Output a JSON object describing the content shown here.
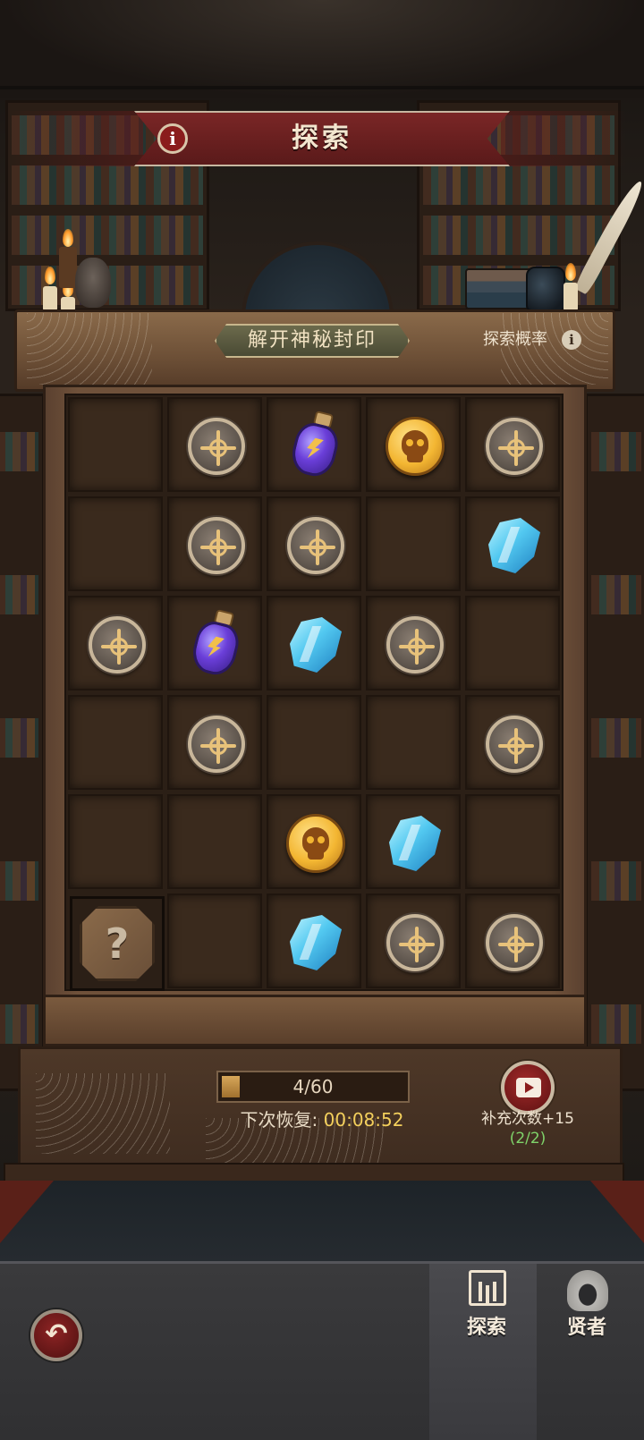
{
  "header": {
    "title": "探索",
    "info_label": "i"
  },
  "unseal_label": "解开神秘封印",
  "probability_label": "探索概率",
  "probability_info": "i",
  "grid": {
    "rows": [
      [
        "empty",
        "medal",
        "potion",
        "coin",
        "medal"
      ],
      [
        "empty",
        "medal",
        "medal",
        "empty",
        "crystal"
      ],
      [
        "medal",
        "potion",
        "crystal",
        "medal",
        "empty"
      ],
      [
        "empty",
        "medal",
        "empty",
        "empty",
        "medal"
      ],
      [
        "empty",
        "empty",
        "coin",
        "crystal",
        "empty"
      ],
      [
        "mystery",
        "empty",
        "crystal",
        "medal",
        "medal"
      ]
    ],
    "mystery_symbol": "?"
  },
  "energy": {
    "text": "4/60",
    "current": 4,
    "max": 60
  },
  "recovery": {
    "label": "下次恢复:",
    "time": "00:08:52"
  },
  "refill": {
    "label": "补充次数+15",
    "count": "(2/2)"
  },
  "nav": {
    "back_symbol": "↶",
    "tabs": [
      {
        "label": "探索",
        "icon": "explore-library-icon",
        "active": true
      },
      {
        "label": "贤者",
        "icon": "sage-hood-icon",
        "active": false
      }
    ]
  },
  "colors": {
    "banner": "#7a2626",
    "time_highlight": "#f3cf5c",
    "refill_count": "#7fd36a",
    "progress_fill": "#d7a75a"
  }
}
